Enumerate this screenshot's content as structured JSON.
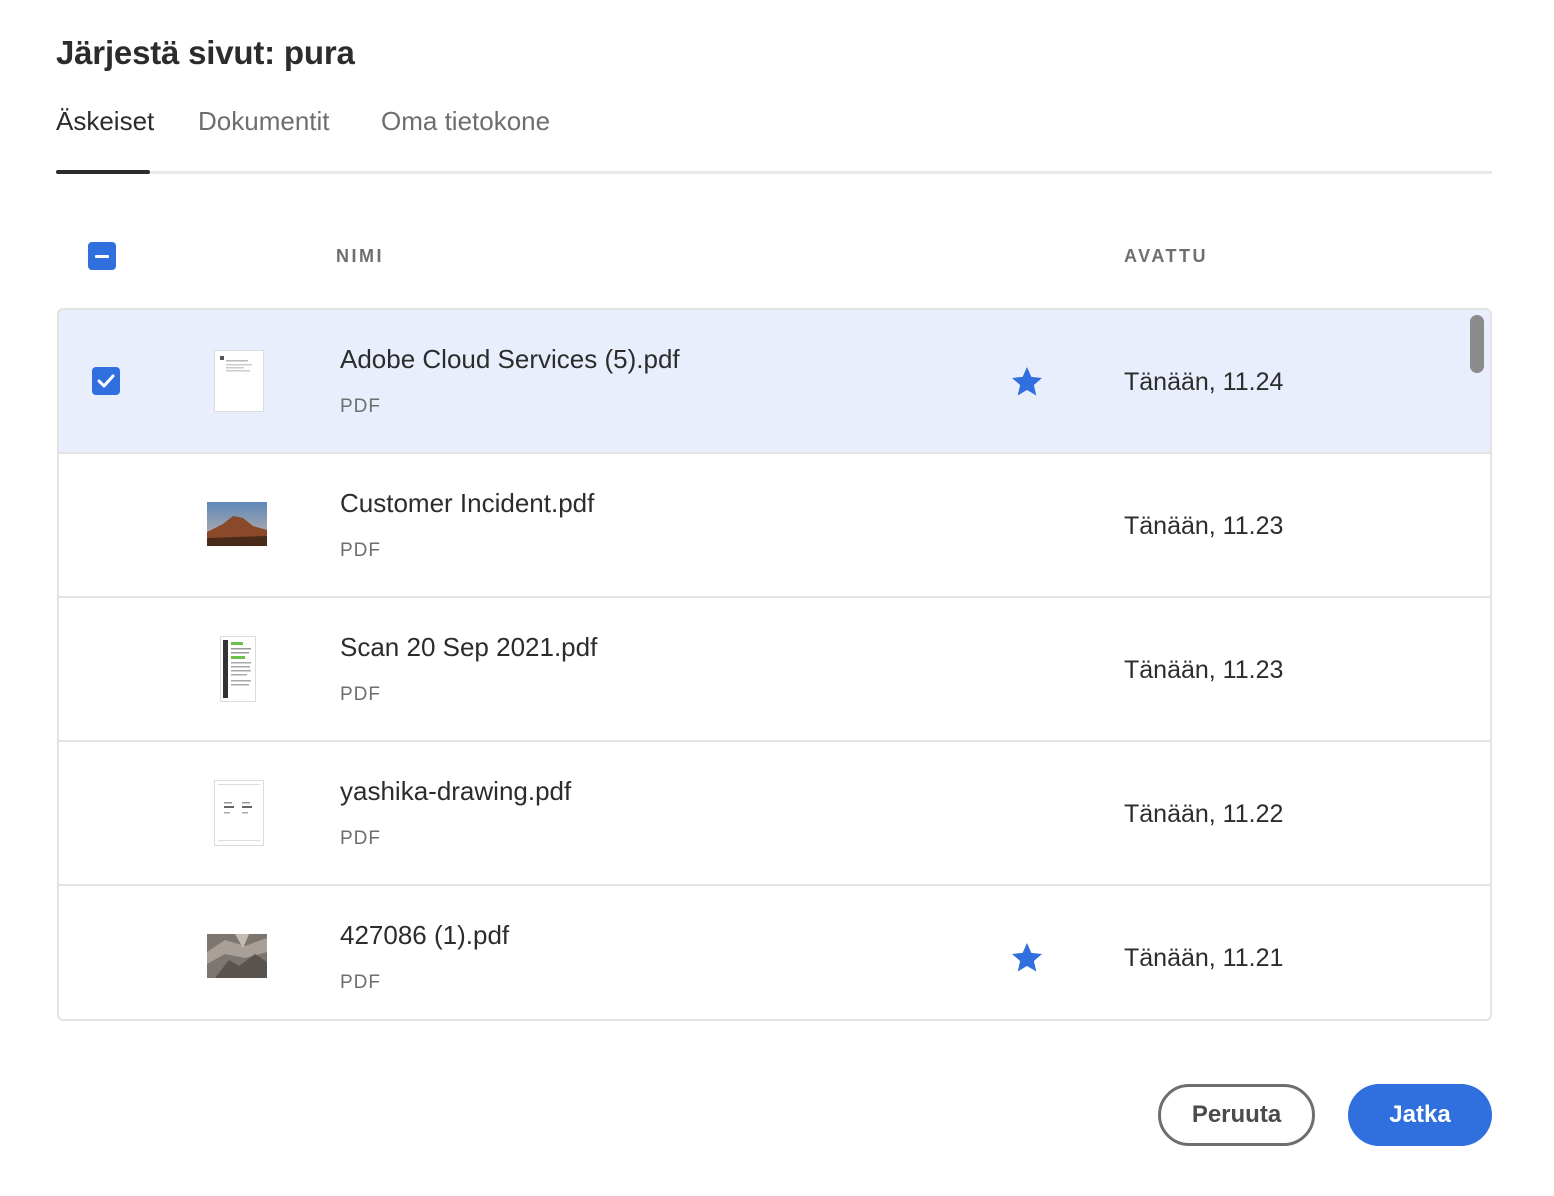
{
  "dialog": {
    "title": "Järjestä sivut: pura"
  },
  "tabs": [
    {
      "label": "Äskeiset",
      "active": true
    },
    {
      "label": "Dokumentit",
      "active": false
    },
    {
      "label": "Oma tietokone",
      "active": false
    }
  ],
  "table": {
    "header_checkbox_state": "indeterminate",
    "columns": {
      "name": "NIMI",
      "opened": "AVATTU"
    },
    "rows": [
      {
        "name": "Adobe Cloud Services (5).pdf",
        "type": "PDF",
        "opened": "Tänään, 11.24",
        "starred": true,
        "selected": true,
        "thumbnail": "document-page"
      },
      {
        "name": "Customer Incident.pdf",
        "type": "PDF",
        "opened": "Tänään, 11.23",
        "starred": false,
        "selected": false,
        "thumbnail": "landscape-photo"
      },
      {
        "name": "Scan 20 Sep 2021.pdf",
        "type": "PDF",
        "opened": "Tänään, 11.23",
        "starred": false,
        "selected": false,
        "thumbnail": "scanned-page"
      },
      {
        "name": "yashika-drawing.pdf",
        "type": "PDF",
        "opened": "Tänään, 11.22",
        "starred": false,
        "selected": false,
        "thumbnail": "drawing-page"
      },
      {
        "name": "427086 (1).pdf",
        "type": "PDF",
        "opened": "Tänään, 11.21",
        "starred": true,
        "selected": false,
        "thumbnail": "rock-photo"
      }
    ]
  },
  "buttons": {
    "cancel": "Peruuta",
    "continue": "Jatka"
  },
  "colors": {
    "accent": "#2f6fde",
    "selected_row": "#e8eefb",
    "text": "#2c2c2c",
    "muted": "#6e6e6e"
  }
}
